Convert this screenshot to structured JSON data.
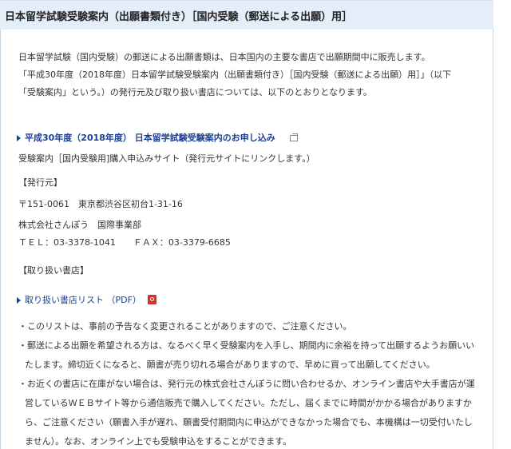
{
  "header": {
    "title": "日本留学試験受験案内（出願書類付き）［国内受験（郵送による出願）用］"
  },
  "intro": {
    "line1": "日本留学試験（国内受験）の郵送による出願書類は、日本国内の主要な書店で出願期間中に販売します。",
    "line2": "「平成30年度（2018年度）日本留学試験受験案内（出願書類付き）［国内受験（郵送による出願）用］」（以下",
    "line3": "「受験案内」という。）の発行元及び取り扱い書店については、以下のとおりとなります。"
  },
  "order_link": {
    "label": "平成30年度（2018年度） 日本留学試験受験案内のお申し込み",
    "icon": "external-window-icon",
    "description": "受験案内［国内受験用]購入申込みサイト（発行元サイトにリンクします。）"
  },
  "publisher": {
    "heading": "【発行元】",
    "address": "〒151-0061　東京都渋谷区初台1-31-16",
    "company": "株式会社さんぽう　国際事業部",
    "contact": "ＴＥＬ：03-3378-1041　　ＦＡＸ：03-3379-6685"
  },
  "stores": {
    "heading": "【取り扱い書店】",
    "link_label": "取り扱い書店リスト （PDF）",
    "icon": "pdf-icon"
  },
  "notes": {
    "n1": "・このリストは、事前の予告なく変更されることがありますので、ご注意ください。",
    "n2a": "・郵送による出願を希望される方は、なるべく早く受験案内を入手し、期間内に余裕を持って出願するようお願いい",
    "n2b": "たします。締切近くになると、願書が売り切れる場合がありますので、早めに買って出願してください。",
    "n3a": "・お近くの書店に在庫がない場合は、発行元の株式会社さんぽうに問い合わせるか、オンライン書店や大手書店が運",
    "n3b": "営しているＷＥＢサイト等から通信販売で購入してください。ただし、届くまでに時間がかかる場合がありますか",
    "n3c": "ら、ご注意ください（願書入手が遅れ、願書受付期間内に申込ができなかった場合でも、本機構は一切受付いたし",
    "n3d": "ません）。なお、オンライン上でも受験申込をすることができます。"
  },
  "colors": {
    "header_bg": "#e3eef8",
    "link": "#1b3f95",
    "text": "#333333",
    "pdf_icon": "#d8322a"
  }
}
